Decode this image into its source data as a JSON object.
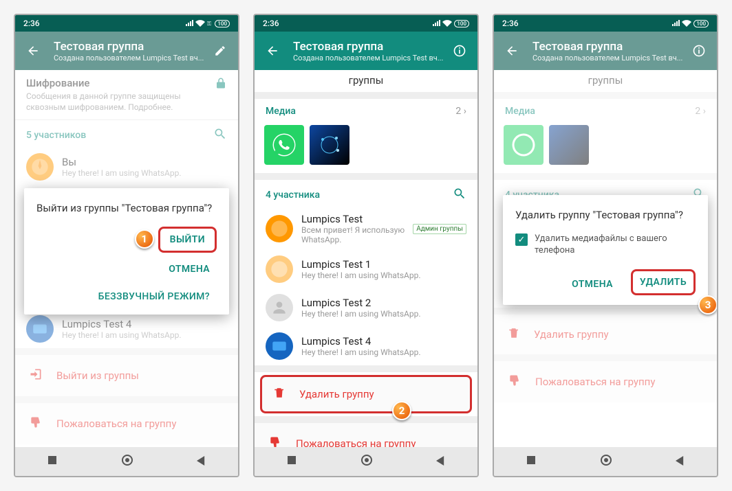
{
  "status": {
    "time": "2:36",
    "battery": "100"
  },
  "header": {
    "title": "Тестовая группа",
    "subtitle": "Создана пользователем Lumpics Test вч..."
  },
  "partial_top": "группы",
  "encryption": {
    "title": "Шифрование",
    "text": "Сообщения в данной группе защищены сквозным шифрованием. Подробнее."
  },
  "media": {
    "label": "Медиа",
    "count": "2",
    "chevron": "›"
  },
  "members5": "5 участников",
  "members4": "4 участника",
  "you": {
    "name": "Вы",
    "status": "Hey there! I am using WhatsApp."
  },
  "m1": {
    "name": "Lumpics Test",
    "status": "Всем привет! Я использую WhatsApp.",
    "admin": "Админ группы"
  },
  "m2": {
    "name": "Lumpics Test 1",
    "status": "Hey there! I am using WhatsApp."
  },
  "m3": {
    "name": "Lumpics Test 2",
    "status": "Hey there! I am using WhatsApp."
  },
  "m4": {
    "name": "Lumpics Test 4",
    "status": "Hey there! I am using WhatsApp."
  },
  "actions": {
    "exit": "Выйти из группы",
    "delete": "Удалить группу",
    "report": "Пожаловаться на группу"
  },
  "dialog_exit": {
    "question": "Выйти из группы \"Тестовая группа\"?",
    "exit": "ВЫЙТИ",
    "cancel": "ОТМЕНА",
    "mute": "БЕЗЗВУЧНЫЙ РЕЖИМ?"
  },
  "dialog_delete": {
    "question": "Удалить группу \"Тестовая группа\"?",
    "check": "Удалить медиафайлы с вашего телефона",
    "cancel": "ОТМЕНА",
    "delete": "УДАЛИТЬ"
  },
  "steps": {
    "s1": "1",
    "s2": "2",
    "s3": "3"
  }
}
